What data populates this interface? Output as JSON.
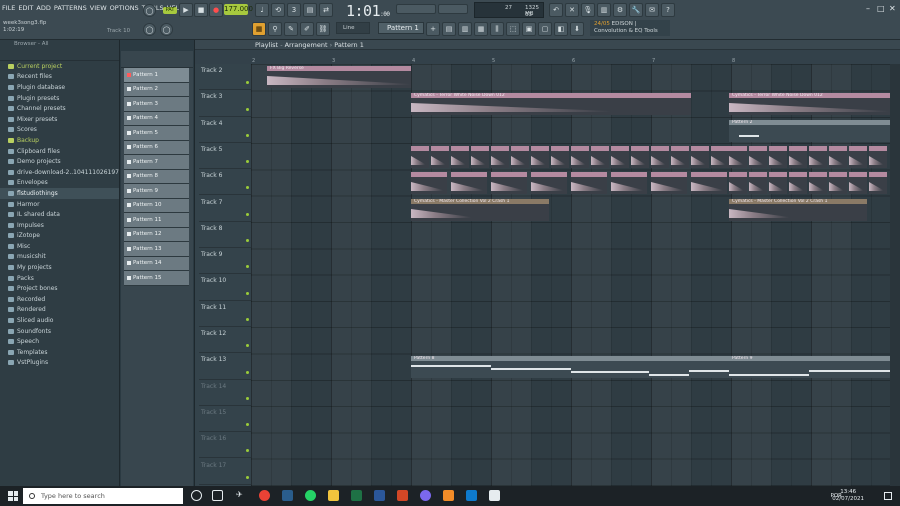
{
  "menu": [
    "FILE",
    "EDIT",
    "ADD",
    "PATTERNS",
    "VIEW",
    "OPTIONS",
    "TOOLS",
    "HELP"
  ],
  "song": {
    "filename": "week3song3.flp",
    "time": "1:02:19",
    "track_hint": "Track 10"
  },
  "transport": {
    "pattern_toggle": "PAT",
    "bpm": "177.000",
    "time_main": "1:01",
    "time_sub": ":00"
  },
  "monitor": {
    "cpu": "27",
    "memory": "1325 MB",
    "polyphony": "63"
  },
  "snap": "Line",
  "pattern_selector": "Pattern 1",
  "hint": {
    "num": "24/05",
    "title": "EDISON |",
    "desc": "Convolution & EQ Tools"
  },
  "browser": {
    "title": "Browser - All",
    "items": [
      {
        "label": "Current project",
        "accent": true
      },
      {
        "label": "Recent files"
      },
      {
        "label": "Plugin database"
      },
      {
        "label": "Plugin presets"
      },
      {
        "label": "Channel presets"
      },
      {
        "label": "Mixer presets"
      },
      {
        "label": "Scores"
      },
      {
        "label": "Backup",
        "accent": true
      },
      {
        "label": "Clipboard files"
      },
      {
        "label": "Demo projects"
      },
      {
        "label": "drive-download-2..104111026197.001"
      },
      {
        "label": "Envelopes"
      },
      {
        "label": "flstudiothings",
        "highlight": true
      },
      {
        "label": "Harmor"
      },
      {
        "label": "IL shared data"
      },
      {
        "label": "Impulses"
      },
      {
        "label": "iZotope"
      },
      {
        "label": "Misc"
      },
      {
        "label": "musicshit"
      },
      {
        "label": "My projects"
      },
      {
        "label": "Packs"
      },
      {
        "label": "Project bones"
      },
      {
        "label": "Recorded"
      },
      {
        "label": "Rendered"
      },
      {
        "label": "Sliced audio"
      },
      {
        "label": "Soundfonts"
      },
      {
        "label": "Speech"
      },
      {
        "label": "Templates"
      },
      {
        "label": "VstPlugins"
      }
    ]
  },
  "patterns": [
    "Pattern 1",
    "Pattern 2",
    "Pattern 3",
    "Pattern 4",
    "Pattern 5",
    "Pattern 6",
    "Pattern 7",
    "Pattern 8",
    "Pattern 9",
    "Pattern 10",
    "Pattern 11",
    "Pattern 12",
    "Pattern 13",
    "Pattern 14",
    "Pattern 15"
  ],
  "playlist": {
    "breadcrumb": [
      "Playlist",
      "Arrangement",
      "Pattern 1"
    ],
    "ruler": [
      "2",
      "3",
      "4",
      "5",
      "6",
      "7",
      "8"
    ],
    "tracks": [
      "Track 2",
      "Track 3",
      "Track 4",
      "Track 5",
      "Track 6",
      "Track 7",
      "Track 8",
      "Track 9",
      "Track 10",
      "Track 11",
      "Track 12",
      "Track 13",
      "Track 14",
      "Track 15",
      "Track 16",
      "Track 17"
    ],
    "clips": {
      "fx": "FX Big Reverse",
      "terror1": "Cymatics - Terror White Noise Down 012",
      "terror2": "Cymatics - Terror White Noise Down 012",
      "pattern2": "Pattern 2",
      "crash1": "Cymatics - Master Collection Vol 2 Crash 1",
      "crash2": "Cymatics - Master Collection Vol 2 Crash 1",
      "pattern8": "Pattern 8",
      "pattern9": "Pattern 9"
    }
  },
  "taskbar": {
    "search_placeholder": "Type here to search",
    "lang": "POR",
    "clock": "13:46",
    "date": "02/07/2021"
  }
}
